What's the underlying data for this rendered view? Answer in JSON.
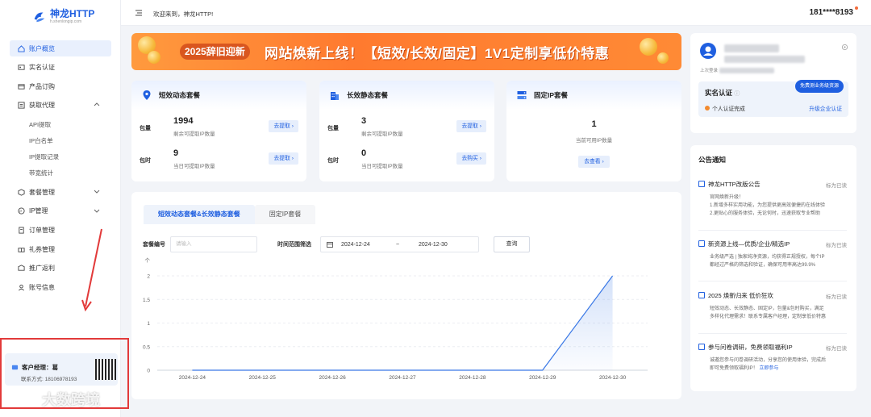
{
  "brand": {
    "name": "神龙HTTP",
    "url": "h.shenlongip.com"
  },
  "topbar": {
    "welcome": "欢迎来到，神龙HTTP!",
    "user": "181****8193"
  },
  "sidebar": {
    "items": [
      {
        "label": "账户概览"
      },
      {
        "label": "实名认证"
      },
      {
        "label": "产品订购"
      },
      {
        "label": "获取代理"
      },
      {
        "label": "套餐管理"
      },
      {
        "label": "IP管理"
      },
      {
        "label": "订单管理"
      },
      {
        "label": "礼券管理"
      },
      {
        "label": "推广返利"
      },
      {
        "label": "账号信息"
      }
    ],
    "sub_items": [
      "API提取",
      "IP白名单",
      "IP提取记录",
      "带宽统计"
    ],
    "manager": {
      "title": "客户经理：葛",
      "contact": "联系方式: 18106978193"
    }
  },
  "watermark": {
    "text": "大数跨境"
  },
  "banner": {
    "chip": "2025辞旧迎新",
    "text": "网站焕新上线！【短效/长效/固定】1V1定制享低价特惠"
  },
  "packages": [
    {
      "title": "短效动态套餐",
      "rows": [
        {
          "label": "包量",
          "value": "1994",
          "desc": "剩余可提取IP数量",
          "button": "去提取 ›"
        },
        {
          "label": "包时",
          "value": "9",
          "desc": "当日可提取IP数量",
          "button": "去提取 ›"
        }
      ]
    },
    {
      "title": "长效静态套餐",
      "rows": [
        {
          "label": "包量",
          "value": "3",
          "desc": "剩余可提取IP数量",
          "button": "去提取 ›"
        },
        {
          "label": "包时",
          "value": "0",
          "desc": "当日可提取IP数量",
          "button": "去购买 ›"
        }
      ]
    },
    {
      "title": "固定IP套餐",
      "value": "1",
      "desc": "当前可用IP数量",
      "button": "去查看 ›"
    }
  ],
  "usage": {
    "tabs": [
      "短效动态套餐&长效静态套餐",
      "固定IP套餐"
    ],
    "filter": {
      "package_label": "套餐编号",
      "package_placeholder": "请输入",
      "range_label": "时间范围筛选",
      "start": "2024-12-24",
      "sep": "~",
      "end": "2024-12-30",
      "query": "查询"
    }
  },
  "chart_data": {
    "type": "area",
    "x": [
      "2024-12-24",
      "2024-12-25",
      "2024-12-26",
      "2024-12-27",
      "2024-12-28",
      "2024-12-29",
      "2024-12-30"
    ],
    "series": [
      {
        "values": [
          0,
          0,
          0,
          0,
          0,
          0,
          2
        ]
      }
    ],
    "y_ticks": [
      "0",
      "0.5",
      "1",
      "1.5",
      "2"
    ],
    "y_axis_title": "个",
    "ylim": [
      0,
      2
    ],
    "grid": true,
    "color": "#3a78e6"
  },
  "profile": {
    "last_login_label": "上次登录",
    "verify_title": "实名认证",
    "verify_status": "个人认证完成",
    "verify_upgrade": "升级企业认证",
    "verify_pill": "免费测业务级资源"
  },
  "notices": {
    "title": "公告通知",
    "items": [
      {
        "title": "神龙HTTP改版公告",
        "tag": "标为已读",
        "body": [
          "官网焕新升级！",
          "1.新增多样实用功能，为您提供更高效便捷的在线体验",
          "2.更贴心的服务体验，无论何时，迅速获取专业帮助"
        ]
      },
      {
        "title": "新资源上线—优质/企业/精选IP",
        "tag": "标为已读",
        "body": [
          "业务级严选 | 独家纯净资源，均获得正规授权，每个IP",
          "都经过严格的筛选和验证，确保可用率高达99.9%"
        ]
      },
      {
        "title": "2025 焕新归来 低价狂欢",
        "tag": "标为已读",
        "body": [
          "短效动态、长效静态、固定IP，包量&包时购买，满足",
          "多样化代理需求！联系专属客户经理，定制享低价特惠"
        ]
      },
      {
        "title": "参与问卷调研，免费领取福利IP",
        "tag": "标为已读",
        "body": [
          "诚邀您参与问卷调研活动，分享您的使用体验，完成后",
          "即可免费领取福利IP！"
        ],
        "link": "立即参与"
      }
    ]
  }
}
